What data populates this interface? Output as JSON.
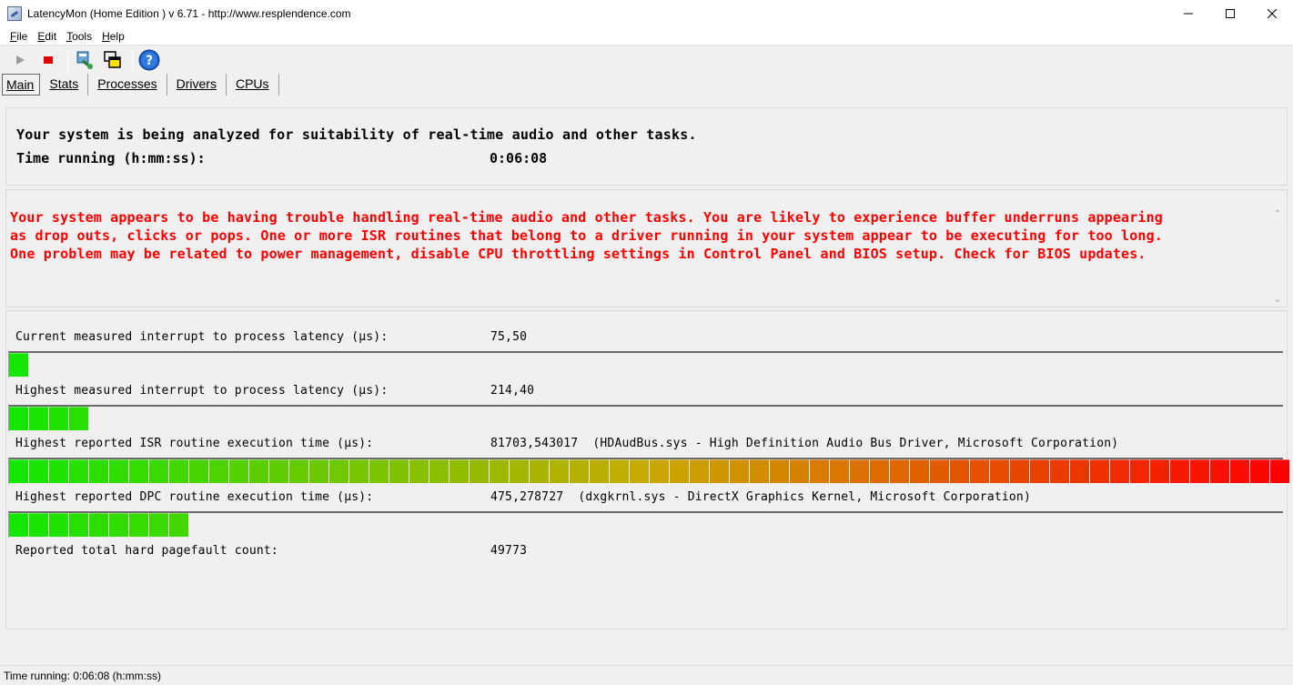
{
  "window": {
    "title": "LatencyMon  (Home Edition )  v 6.71 - http://www.resplendence.com",
    "controls": {
      "minimize": "—",
      "maximize": "☐",
      "close": "✕"
    }
  },
  "menu": [
    {
      "accel": "F",
      "rest": "ile"
    },
    {
      "accel": "E",
      "rest": "dit"
    },
    {
      "accel": "T",
      "rest": "ools"
    },
    {
      "accel": "H",
      "rest": "elp"
    }
  ],
  "toolbar": {
    "icons": [
      "play-icon",
      "stop-icon",
      "report-icon",
      "windows-icon",
      "help-icon"
    ]
  },
  "tabs": [
    {
      "label": "Main",
      "active": true
    },
    {
      "label": "Stats"
    },
    {
      "label": "Processes"
    },
    {
      "label": "Drivers"
    },
    {
      "label": "CPUs"
    }
  ],
  "summary": {
    "analyzing": "Your system is being analyzed for suitability of real-time audio and other tasks.",
    "time_label": "Time running (h:mm:ss):",
    "time_value": "0:06:08"
  },
  "warning": {
    "text": "Your system appears to be having trouble handling real-time audio and other tasks. You are likely to experience buffer underruns appearing\nas drop outs, clicks or pops. One or more ISR routines that belong to a driver running in your system appear to be executing for too long.\nOne problem may be related to power management, disable CPU throttling settings in Control Panel and BIOS setup. Check for BIOS updates.",
    "color": "#ff0000"
  },
  "metrics": [
    {
      "label": "Current measured interrupt to process latency (µs):",
      "value": "75,50",
      "segments": 1
    },
    {
      "label": "Highest measured interrupt to process latency (µs):",
      "value": "214,40",
      "segments": 4
    },
    {
      "label": "Highest reported ISR routine execution time (µs):",
      "value": "81703,543017  (HDAudBus.sys - High Definition Audio Bus Driver, Microsoft Corporation)",
      "segments": 64
    },
    {
      "label": "Highest reported DPC routine execution time (µs):",
      "value": "475,278727  (dxgkrnl.sys - DirectX Graphics Kernel, Microsoft Corporation)",
      "segments": 9
    },
    {
      "label": "Reported total hard pagefault count:",
      "value": "49773"
    }
  ],
  "status": {
    "text": "Time running: 0:06:08  (h:mm:ss)"
  }
}
